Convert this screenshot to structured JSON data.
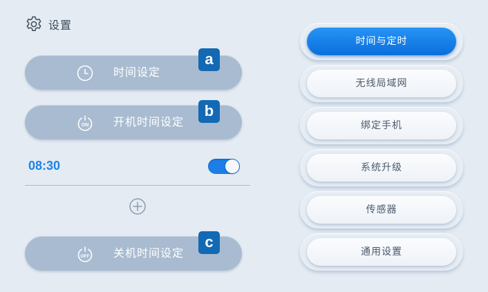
{
  "header": {
    "title": "设置",
    "icon": "gear-icon"
  },
  "left": {
    "power_time_button": {
      "label": "时间设定",
      "icon": "clock-icon",
      "badge": "a"
    },
    "power_on_button": {
      "label": "开机时间设定",
      "icon": "power-on-icon",
      "icon_text": "ON",
      "badge": "b"
    },
    "schedule": {
      "time": "08:30",
      "enabled": true
    },
    "add_icon": "plus-circle-icon",
    "power_off_button": {
      "label": "关机时间设定",
      "icon": "power-off-icon",
      "icon_text": "OFF",
      "badge": "c"
    }
  },
  "menu": {
    "items": [
      {
        "label": "时间与定时",
        "active": true
      },
      {
        "label": "无线局域网",
        "active": false
      },
      {
        "label": "绑定手机",
        "active": false
      },
      {
        "label": "系统升级",
        "active": false
      },
      {
        "label": "传感器",
        "active": false
      },
      {
        "label": "通用设置",
        "active": false
      }
    ]
  },
  "colors": {
    "background": "#e4ebf3",
    "pill": "#a9bbd0",
    "badge": "#1369b3",
    "accent": "#1c83e8",
    "text_dark": "#3e4a5a"
  }
}
